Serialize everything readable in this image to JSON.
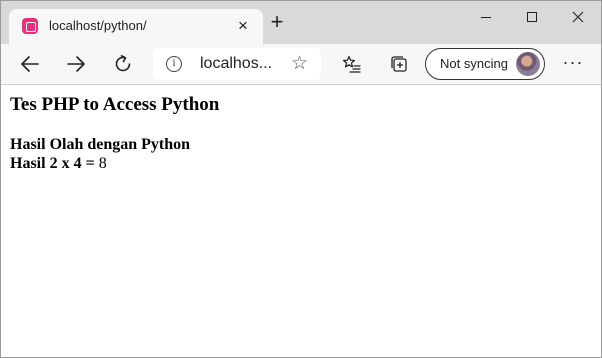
{
  "tab": {
    "title": "localhost/python/",
    "close_label": "×",
    "new_tab_label": "+"
  },
  "toolbar": {
    "url": "localhos...",
    "info_label": "i",
    "favorite_label": "☆",
    "sync_label": "Not syncing",
    "more_label": "···"
  },
  "page": {
    "heading": "Tes PHP to Access Python",
    "line1": "Hasil Olah dengan Python",
    "line2_label": "Hasil 2 x 4 =",
    "line2_value": "8"
  }
}
